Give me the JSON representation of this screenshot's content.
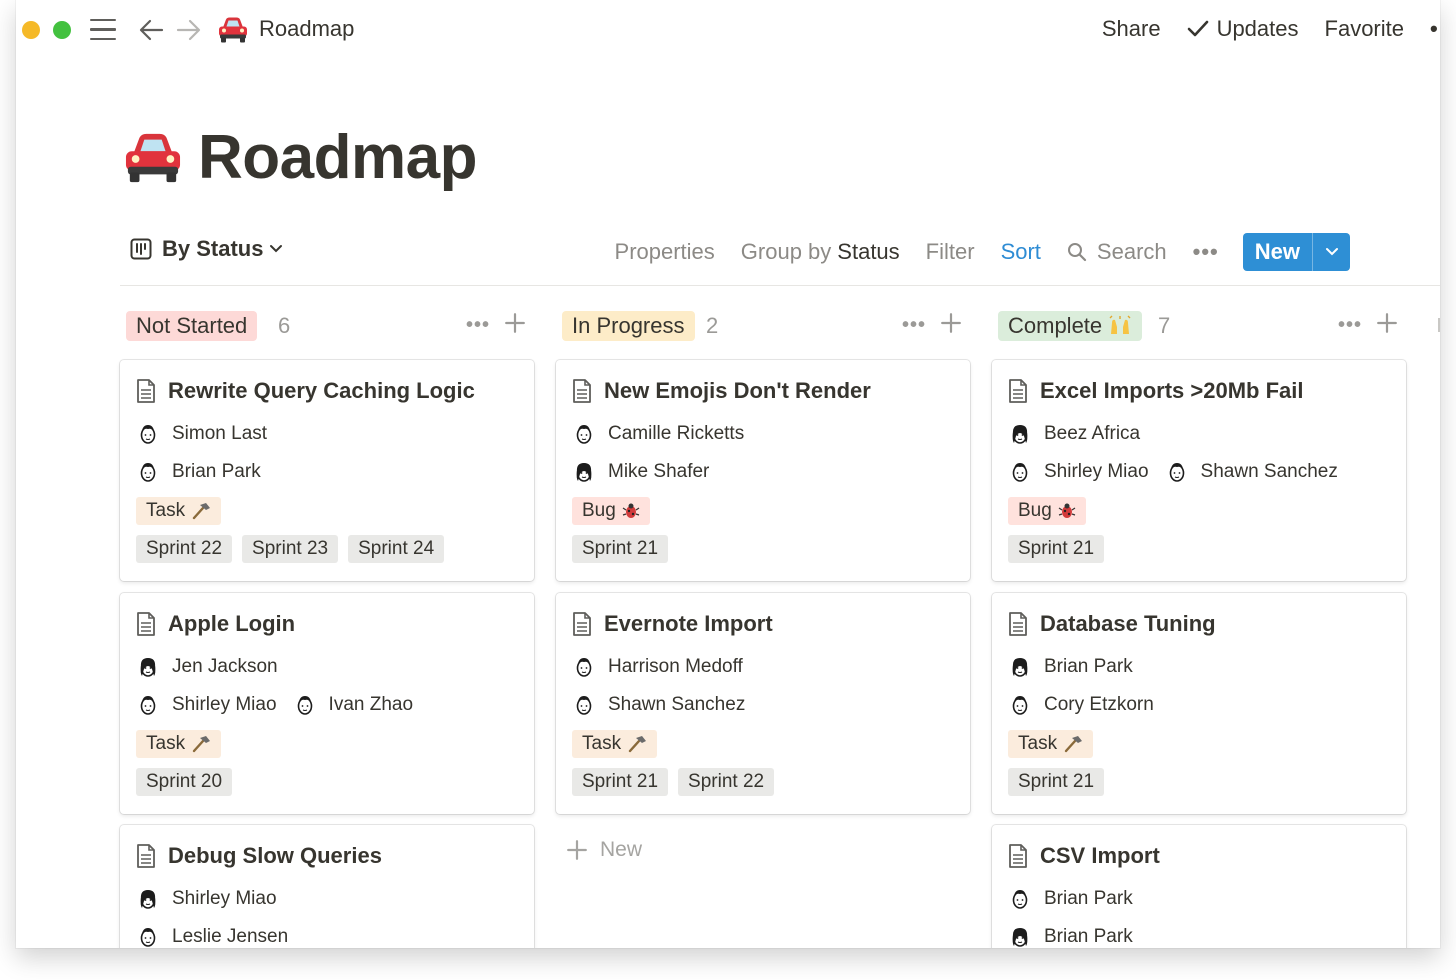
{
  "topbar": {
    "title": "Roadmap",
    "emoji_icon": "car-icon",
    "share": "Share",
    "updates": "Updates",
    "favorite": "Favorite",
    "more": "•"
  },
  "page": {
    "title": "Roadmap",
    "emoji_icon": "car-icon"
  },
  "toolbar": {
    "view_name": "By Status",
    "properties": "Properties",
    "group_by_label": "Group by",
    "group_by_value": "Status",
    "filter": "Filter",
    "sort": "Sort",
    "search": "Search",
    "more": "•••",
    "new_label": "New"
  },
  "colors": {
    "not_started": "#fdd9d7",
    "in_progress": "#fdecc8",
    "complete": "#dbeddb",
    "task": "#fbecdd",
    "bug": "#ffe2dd",
    "sprint": "#e9e9e7",
    "accent": "#2e8fd5"
  },
  "columns": [
    {
      "status": "Not Started",
      "count": "6",
      "cards": [
        {
          "title": "Rewrite Query Caching Logic",
          "people": [
            [
              "Simon Last"
            ],
            [
              "Brian Park"
            ]
          ],
          "type": "Task",
          "type_icon": "hammer-icon",
          "sprints": [
            "Sprint 22",
            "Sprint 23",
            "Sprint 24"
          ]
        },
        {
          "title": "Apple Login",
          "people": [
            [
              "Jen Jackson"
            ],
            [
              "Shirley Miao",
              "Ivan Zhao"
            ]
          ],
          "type": "Task",
          "type_icon": "hammer-icon",
          "sprints": [
            "Sprint 20"
          ]
        },
        {
          "title": "Debug Slow Queries",
          "people": [
            [
              "Shirley Miao"
            ],
            [
              "Leslie Jensen"
            ]
          ]
        }
      ]
    },
    {
      "status": "In Progress",
      "count": "2",
      "cards": [
        {
          "title": "New Emojis Don't Render",
          "people": [
            [
              "Camille Ricketts"
            ],
            [
              "Mike Shafer"
            ]
          ],
          "type": "Bug",
          "type_icon": "bug-icon",
          "sprints": [
            "Sprint 21"
          ]
        },
        {
          "title": "Evernote Import",
          "people": [
            [
              "Harrison Medoff"
            ],
            [
              "Shawn Sanchez"
            ]
          ],
          "type": "Task",
          "type_icon": "hammer-icon",
          "sprints": [
            "Sprint 21",
            "Sprint 22"
          ]
        }
      ],
      "new_label": "New"
    },
    {
      "status": "Complete",
      "status_icon": "raised-hands-icon",
      "count": "7",
      "cards": [
        {
          "title": "Excel Imports >20Mb Fail",
          "people": [
            [
              "Beez Africa"
            ],
            [
              "Shirley Miao",
              "Shawn Sanchez"
            ]
          ],
          "type": "Bug",
          "type_icon": "bug-icon",
          "sprints": [
            "Sprint 21"
          ]
        },
        {
          "title": "Database Tuning",
          "people": [
            [
              "Brian Park"
            ],
            [
              "Cory Etzkorn"
            ]
          ],
          "type": "Task",
          "type_icon": "hammer-icon",
          "sprints": [
            "Sprint 21"
          ]
        },
        {
          "title": "CSV Import",
          "people": [
            [
              "Brian Park"
            ],
            [
              "Brian Park"
            ]
          ]
        }
      ]
    }
  ]
}
